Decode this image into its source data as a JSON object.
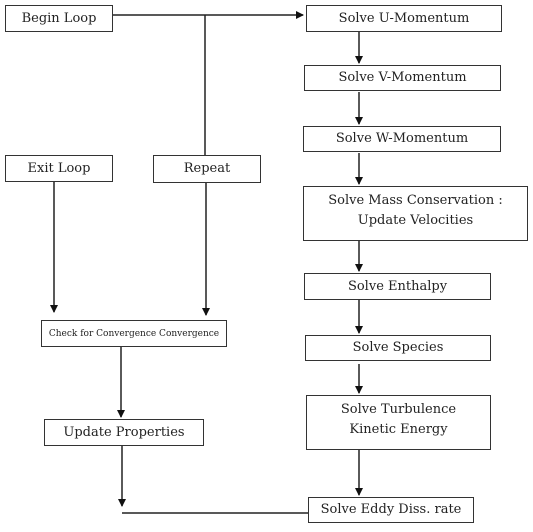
{
  "diagram": {
    "title": "",
    "nodes": {
      "begin_loop": "Begin Loop",
      "exit_loop": "Exit Loop",
      "repeat": "Repeat",
      "check_convergence": "Check for Convergence Convergence",
      "update_properties": "Update Properties",
      "solve_u": "Solve U-Momentum",
      "solve_v": "Solve V-Momentum",
      "solve_w": "Solve W-Momentum",
      "solve_mass": "Solve Mass Conservation :\n   Update Velocities",
      "solve_enthalpy": "Solve Enthalpy",
      "solve_species": "Solve Species",
      "solve_turbulence": "Solve Turbulence\nKinetic Energy",
      "solve_eddy": "Solve Eddy Diss. rate"
    },
    "edges": [
      {
        "from": "begin_loop",
        "to": "solve_u"
      },
      {
        "from": "solve_u",
        "to": "solve_v"
      },
      {
        "from": "solve_v",
        "to": "solve_w"
      },
      {
        "from": "solve_w",
        "to": "solve_mass"
      },
      {
        "from": "solve_mass",
        "to": "solve_enthalpy"
      },
      {
        "from": "solve_enthalpy",
        "to": "solve_species"
      },
      {
        "from": "solve_species",
        "to": "solve_turbulence"
      },
      {
        "from": "solve_turbulence",
        "to": "solve_eddy"
      },
      {
        "from": "solve_eddy",
        "to": "update_properties"
      },
      {
        "from": "update_properties",
        "to": "check_convergence"
      },
      {
        "from": "check_convergence",
        "to": "exit_loop"
      },
      {
        "from": "check_convergence",
        "to": "repeat"
      },
      {
        "from": "repeat",
        "to": "begin_loop"
      }
    ]
  }
}
